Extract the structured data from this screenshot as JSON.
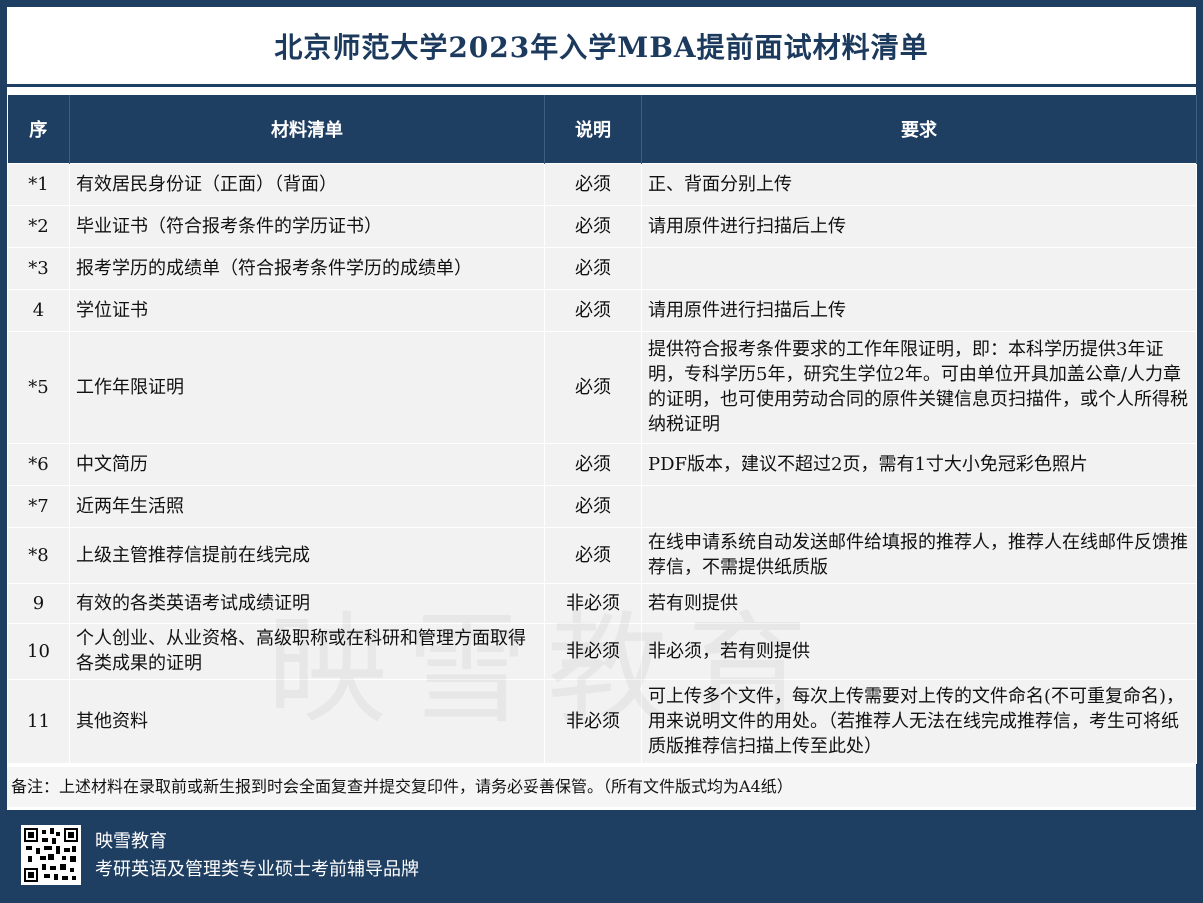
{
  "title": "北京师范大学2023年入学MBA提前面试材料清单",
  "headers": [
    "序",
    "材料清单",
    "说明",
    "要求"
  ],
  "rows": [
    {
      "no": "*1",
      "item": "有效居民身份证（正面）（背面）",
      "note": "必须",
      "req": "正、背面分别上传"
    },
    {
      "no": "*2",
      "item": "毕业证书（符合报考条件的学历证书）",
      "note": "必须",
      "req": "请用原件进行扫描后上传"
    },
    {
      "no": "*3",
      "item": "报考学历的成绩单（符合报考条件学历的成绩单）",
      "note": "必须",
      "req": ""
    },
    {
      "no": "4",
      "item": "学位证书",
      "note": "必须",
      "req": "请用原件进行扫描后上传"
    },
    {
      "no": "*5",
      "item": "工作年限证明",
      "note": "必须",
      "req": "提供符合报考条件要求的工作年限证明，即：本科学历提供3年证明，专科学历5年，研究生学位2年。可由单位开具加盖公章/人力章的证明，也可使用劳动合同的原件关键信息页扫描件，或个人所得税纳税证明"
    },
    {
      "no": "*6",
      "item": "中文简历",
      "note": "必须",
      "req": "PDF版本，建议不超过2页，需有1寸大小免冠彩色照片"
    },
    {
      "no": "*7",
      "item": "近两年生活照",
      "note": "必须",
      "req": ""
    },
    {
      "no": "*8",
      "item": "上级主管推荐信提前在线完成",
      "note": "必须",
      "req": "在线申请系统自动发送邮件给填报的推荐人，推荐人在线邮件反馈推荐信，不需提供纸质版"
    },
    {
      "no": "9",
      "item": "有效的各类英语考试成绩证明",
      "note": "非必须",
      "req": "若有则提供"
    },
    {
      "no": "10",
      "item": "个人创业、从业资格、高级职称或在科研和管理方面取得各类成果的证明",
      "note": "非必须",
      "req": "非必须，若有则提供"
    },
    {
      "no": "11",
      "item": "其他资料",
      "note": "非必须",
      "req": "可上传多个文件，每次上传需要对上传的文件命名(不可重复命名)，用来说明文件的用处。（若推荐人无法在线完成推荐信，考生可将纸质版推荐信扫描上传至此处）"
    }
  ],
  "footnote": "备注：上述材料在录取前或新生报到时会全面复查并提交复印件，请务必妥善保管。（所有文件版式均为A4纸）",
  "watermark": "映雪教育",
  "footer": {
    "brand": "映雪教育",
    "slogan": "考研英语及管理类专业硕士考前辅导品牌",
    "qr_icon": "qr-code-icon"
  },
  "colors": {
    "header_bg": "#1f3f62",
    "title": "#1c3a5e",
    "cell_bg": "#f2f2f2"
  }
}
